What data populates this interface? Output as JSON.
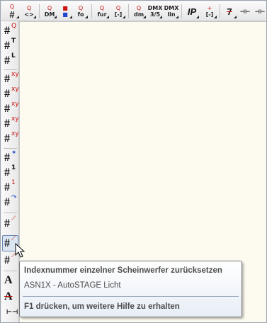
{
  "toolbar": {
    "buttons": [
      {
        "sup": "Q",
        "label": ""
      },
      {
        "sup": "Q",
        "label": "<>"
      },
      {
        "sup": "Q",
        "label": "DM"
      },
      {
        "sup": "Q",
        "label": "fo"
      },
      {
        "sup": "Q",
        "label": "fur"
      },
      {
        "sup": "Q",
        "label": ""
      },
      {
        "sup": "Q",
        "label": "dm"
      },
      {
        "sup": "DMX",
        "label": "3/5"
      },
      {
        "sup": "DMX",
        "label": "lin"
      },
      {
        "sup": "",
        "label": "IP"
      },
      {
        "sup": "",
        "label": ""
      },
      {
        "sup": "",
        "label": "7"
      },
      {
        "sup": "",
        "label": ""
      },
      {
        "sup": "",
        "label": ""
      }
    ]
  },
  "left_toolbar": {
    "buttons": [
      {
        "sup": "Q"
      },
      {
        "sup": "T"
      },
      {
        "sup": "L"
      },
      {
        "sup": "xy"
      },
      {
        "sup": "xy"
      },
      {
        "sup": "xy"
      },
      {
        "sup": "xy"
      },
      {
        "sup": "xy"
      },
      {
        "sup": ""
      },
      {
        "sup": "1"
      },
      {
        "sup": "1"
      },
      {
        "sup": ""
      },
      {
        "sup": ""
      },
      {
        "sup": ""
      },
      {
        "sup": ""
      },
      {
        "sup": ""
      },
      {
        "sup": ""
      },
      {
        "sup": ""
      }
    ]
  },
  "tooltip": {
    "title": "Indexnummer einzelner Scheinwerfer zurücksetzen",
    "body": "ASN1X - AutoSTAGE Licht",
    "help": "F1 drücken, um weitere Hilfe zu erhalten"
  },
  "colors": {
    "accent_red": "#cc1111",
    "canvas": "#fdfbf0"
  }
}
